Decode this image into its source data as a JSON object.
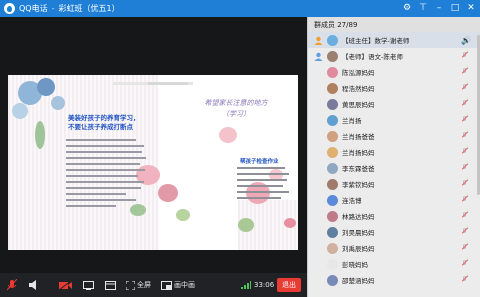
{
  "window": {
    "app_title": "QQ电话",
    "separator": "-",
    "group_name": "彩虹班（优五1）"
  },
  "controls": {
    "fullscreen_label": "全屏",
    "pip_label": "画中画",
    "duration": "33:06",
    "hangup_label": "退出"
  },
  "slide": {
    "left_heading": [
      "美装好孩子的养育学习，",
      "不要让孩子养成打断点"
    ],
    "right_title": "希望家长注意的地方",
    "right_subtitle": "（学习）",
    "right_heading": "帮孩子检查作业"
  },
  "members": {
    "header": "群成员 27/89",
    "list": [
      {
        "name": "【班主任】数学-谢老师",
        "badge": "owner",
        "avatar_color": "#6aaee0",
        "selected": true,
        "muted": false
      },
      {
        "name": "【老师】语文-陈老师",
        "badge": "admin",
        "avatar_color": "#9a8070",
        "selected": false,
        "muted": true
      },
      {
        "name": "陈泓源妈妈",
        "avatar_color": "#e08aa0",
        "muted": true
      },
      {
        "name": "程浩然妈妈",
        "avatar_color": "#b08060",
        "muted": true
      },
      {
        "name": "黄思辰妈妈",
        "avatar_color": "#7a7a9a",
        "muted": true
      },
      {
        "name": "兰肖扬",
        "avatar_color": "#5fa0d0",
        "muted": true
      },
      {
        "name": "兰肖扬爸爸",
        "avatar_color": "#d0a080",
        "muted": true
      },
      {
        "name": "兰肖扬妈妈",
        "avatar_color": "#e0b070",
        "muted": true
      },
      {
        "name": "李东霖爸爸",
        "avatar_color": "#8fa8c0",
        "muted": true
      },
      {
        "name": "李紫钦妈妈",
        "avatar_color": "#a07a6a",
        "muted": true
      },
      {
        "name": "连浩博",
        "avatar_color": "#5a8ad8",
        "muted": true
      },
      {
        "name": "林路达妈妈",
        "avatar_color": "#c07b8a",
        "muted": true
      },
      {
        "name": "刘昊晨妈妈",
        "avatar_color": "#5f7fa0",
        "muted": true
      },
      {
        "name": "刘禹辰妈妈",
        "avatar_color": "#d0b0a0",
        "muted": true
      },
      {
        "name": "彭晓妈妈",
        "avatar_color": "#e7e7e7",
        "muted": true
      },
      {
        "name": "邵楚涵妈妈",
        "avatar_color": "#7a8ab8",
        "muted": true
      }
    ]
  },
  "colors": {
    "titlebar": "#1f7fd7",
    "hangup": "#ea3a34",
    "panel": "#ececec"
  }
}
